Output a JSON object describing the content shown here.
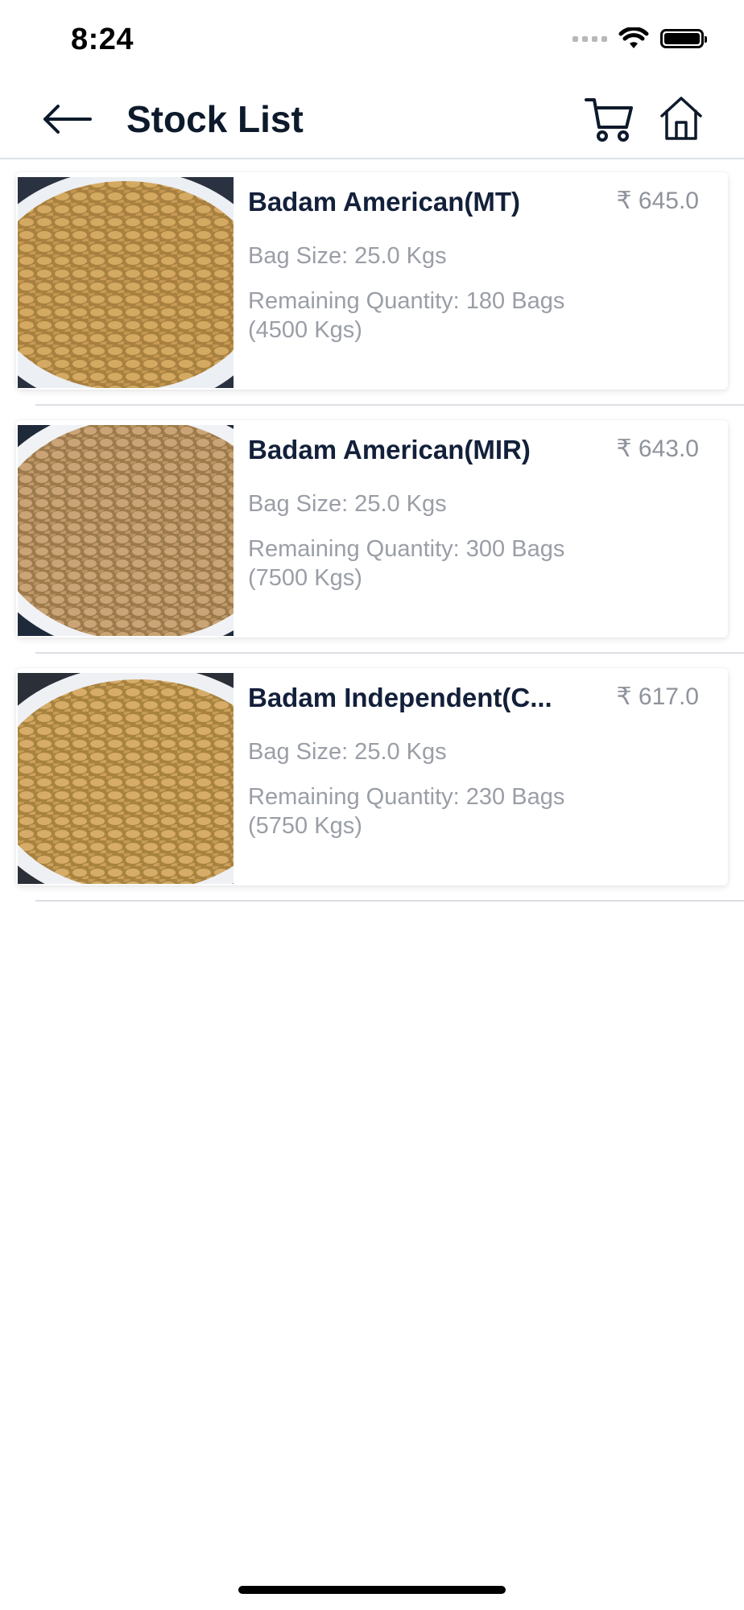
{
  "status_bar": {
    "time": "8:24"
  },
  "nav": {
    "title": "Stock List"
  },
  "items": [
    {
      "name": "Badam American(MT)",
      "price": "₹ 645.0",
      "bag_size": "Bag Size: 25.0 Kgs",
      "remaining": "Remaining Quantity: 180 Bags (4500 Kgs)"
    },
    {
      "name": "Badam American(MIR)",
      "price": "₹ 643.0",
      "bag_size": "Bag Size: 25.0 Kgs",
      "remaining": "Remaining Quantity: 300 Bags (7500 Kgs)"
    },
    {
      "name": "Badam Independent(C...",
      "price": "₹ 617.0",
      "bag_size": "Bag Size: 25.0 Kgs",
      "remaining": "Remaining Quantity: 230 Bags (5750 Kgs)"
    }
  ],
  "colors": {
    "title": "#0d1a2b",
    "secondary_text": "#9a9ea6",
    "divider": "#dcdfe4"
  },
  "icons": {
    "back": "arrow-left-icon",
    "cart": "cart-icon",
    "home": "home-icon",
    "wifi": "wifi-icon",
    "battery": "battery-icon"
  }
}
